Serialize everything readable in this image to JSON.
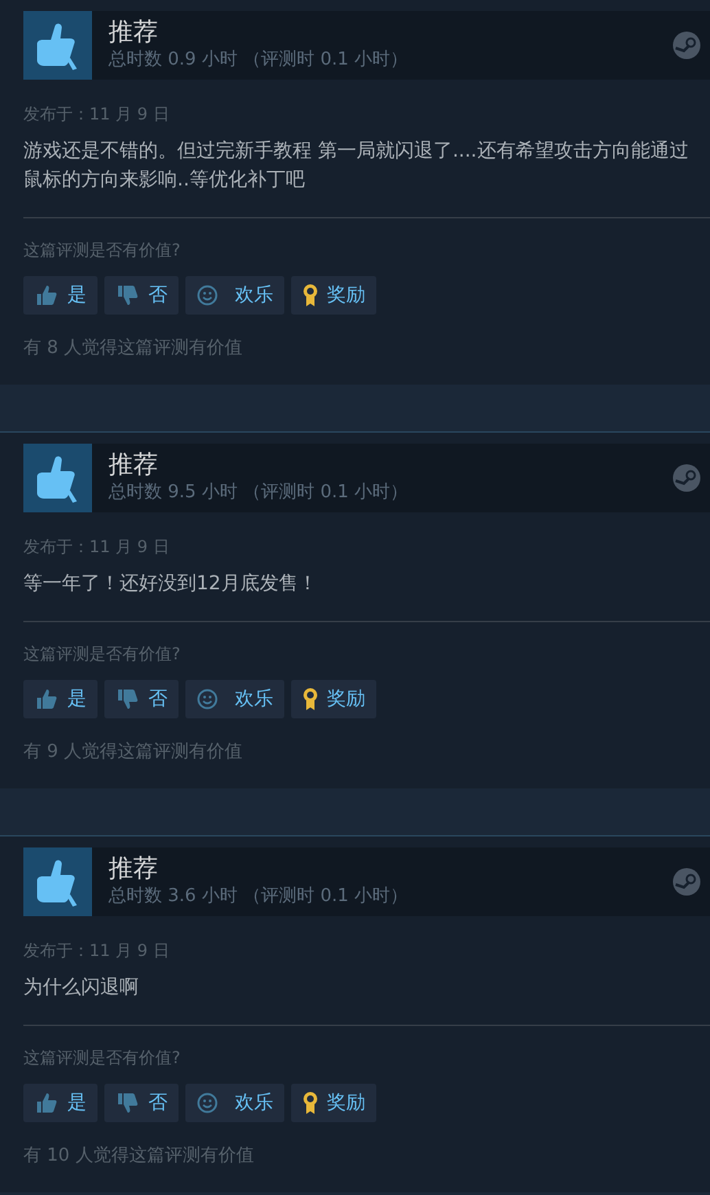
{
  "reviews": [
    {
      "verdict": "推荐",
      "hours": "总时数 0.9 小时 （评测时 0.1 小时）",
      "posted": "发布于：11 月 9 日",
      "body": "游戏还是不错的。但过完新手教程 第一局就闪退了....还有希望攻击方向能通过鼠标的方向来影响..等优化补丁吧",
      "question": "这篇评测是否有价值?",
      "buttons": [
        {
          "kind": "yes",
          "label": "是"
        },
        {
          "kind": "no",
          "label": "否"
        },
        {
          "kind": "funny",
          "label": "欢乐"
        },
        {
          "kind": "award",
          "label": "奖励"
        }
      ],
      "helpful": "有 8 人觉得这篇评测有价值"
    },
    {
      "verdict": "推荐",
      "hours": "总时数 9.5 小时 （评测时 0.1 小时）",
      "posted": "发布于：11 月 9 日",
      "body": "等一年了！还好没到12月底发售！",
      "question": "这篇评测是否有价值?",
      "buttons": [
        {
          "kind": "yes",
          "label": "是"
        },
        {
          "kind": "no",
          "label": "否"
        },
        {
          "kind": "funny",
          "label": "欢乐"
        },
        {
          "kind": "award",
          "label": "奖励"
        }
      ],
      "helpful": "有 9 人觉得这篇评测有价值"
    },
    {
      "verdict": "推荐",
      "hours": "总时数 3.6 小时 （评测时 0.1 小时）",
      "posted": "发布于：11 月 9 日",
      "body": "为什么闪退啊",
      "question": "这篇评测是否有价值?",
      "buttons": [
        {
          "kind": "yes",
          "label": "是"
        },
        {
          "kind": "no",
          "label": "否"
        },
        {
          "kind": "funny",
          "label": "欢乐"
        },
        {
          "kind": "award",
          "label": "奖励"
        }
      ],
      "helpful": "有 10 人觉得这篇评测有价值"
    }
  ]
}
